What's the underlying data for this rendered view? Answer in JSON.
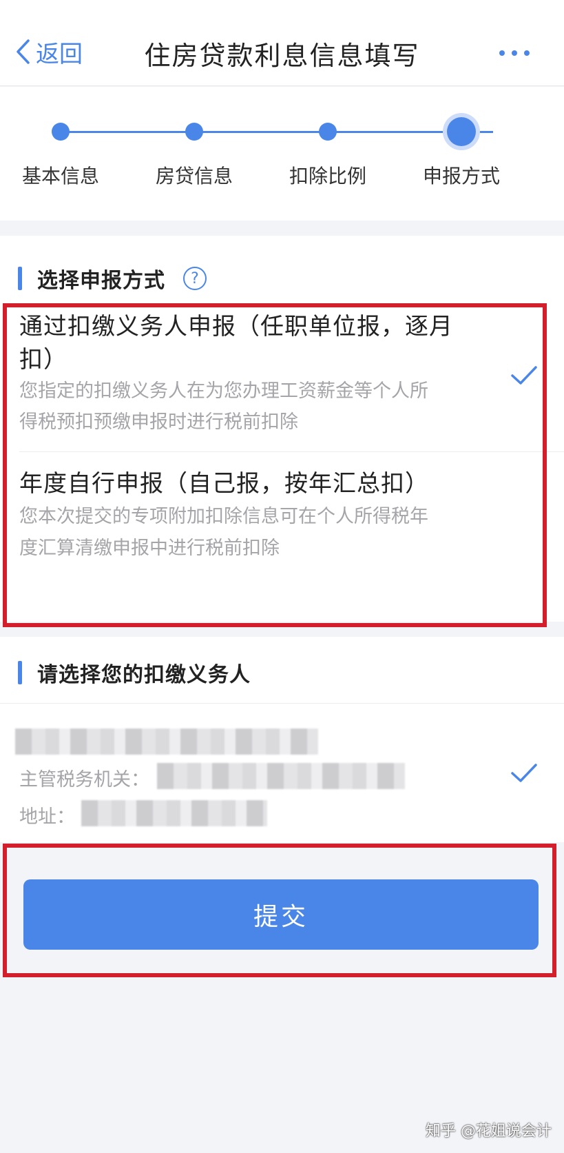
{
  "header": {
    "back_label": "返回",
    "title": "住房贷款利息信息填写"
  },
  "stepper": {
    "steps": [
      {
        "label": "基本信息"
      },
      {
        "label": "房贷信息"
      },
      {
        "label": "扣除比例"
      },
      {
        "label": "申报方式"
      }
    ],
    "current_step": 4
  },
  "filing_method": {
    "title": "选择申报方式",
    "help": "?",
    "options": [
      {
        "title_line1": "通过扣缴义务人申报（任职单位报，逐月",
        "title_line2": "扣）",
        "desc_line1": "您指定的扣缴义务人在为您办理工资薪金等个人所",
        "desc_line2": "得税预扣预缴申报时进行税前扣除",
        "selected": true
      },
      {
        "title_line1": "年度自行申报（自己报，按年汇总扣）",
        "desc_line1": "您本次提交的专项附加扣除信息可在个人所得税年",
        "desc_line2": "度汇算清缴申报中进行税前扣除",
        "selected": false
      }
    ]
  },
  "withholding_agent": {
    "title": "请选择您的扣缴义务人",
    "tax_authority_label": "主管税务机关：",
    "address_label": "地址：",
    "selected": true
  },
  "submit": {
    "label": "提交"
  },
  "watermark": "知乎 @花姐说会计",
  "colors": {
    "accent": "#4a86e8",
    "highlight_box": "#d21f2b",
    "background": "#f3f4f8"
  }
}
